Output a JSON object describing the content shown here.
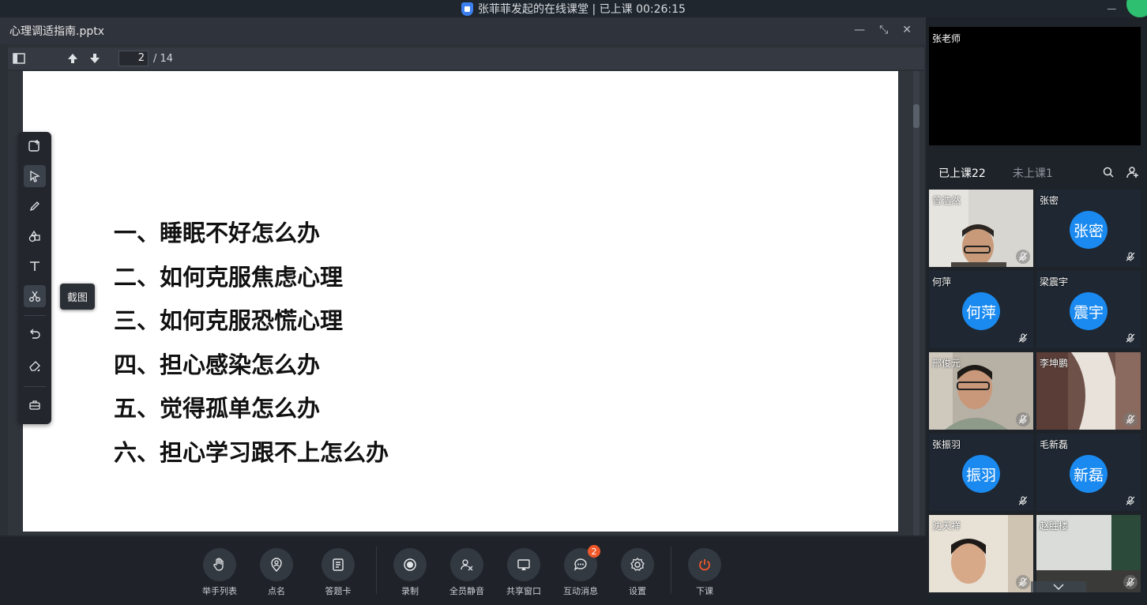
{
  "window": {
    "title": "张菲菲发起的在线课堂 | 已上课 00:26:15"
  },
  "document": {
    "filename": "心理调适指南.pptx",
    "current_page": "2",
    "total_pages": "/ 14",
    "slide_items": [
      "一、睡眠不好怎么办",
      "二、如何克服焦虑心理",
      "三、如何克服恐慌心理",
      "四、担心感染怎么办",
      "五、觉得孤单怎么办",
      "六、担心学习跟不上怎么办"
    ]
  },
  "draw_tools": {
    "tooltip": "截图"
  },
  "bottom_bar": {
    "buttons": [
      {
        "label": "举手列表",
        "icon": "hand-icon"
      },
      {
        "label": "点名",
        "icon": "roll-call-icon"
      },
      {
        "label": "答题卡",
        "icon": "answer-card-icon"
      },
      {
        "label": "录制",
        "icon": "record-icon"
      },
      {
        "label": "全员静音",
        "icon": "mute-all-icon"
      },
      {
        "label": "共享窗口",
        "icon": "share-window-icon"
      },
      {
        "label": "互动消息",
        "icon": "chat-icon",
        "badge": "2"
      },
      {
        "label": "设置",
        "icon": "gear-icon"
      },
      {
        "label": "下课",
        "icon": "power-icon"
      }
    ]
  },
  "side": {
    "teacher_name": "张老师",
    "tab_attending": "已上课22",
    "tab_absent": "未上课1",
    "participants": [
      {
        "name": "曾浩然",
        "avatar": "",
        "type": "video"
      },
      {
        "name": "张密",
        "avatar": "张密",
        "type": "avatar"
      },
      {
        "name": "何萍",
        "avatar": "何萍",
        "type": "avatar"
      },
      {
        "name": "梁震宇",
        "avatar": "震宇",
        "type": "avatar"
      },
      {
        "name": "邢俊元",
        "avatar": "",
        "type": "video"
      },
      {
        "name": "李坤鹏",
        "avatar": "",
        "type": "video"
      },
      {
        "name": "张振羽",
        "avatar": "振羽",
        "type": "avatar"
      },
      {
        "name": "毛新磊",
        "avatar": "新磊",
        "type": "avatar"
      },
      {
        "name": "沈天祥",
        "avatar": "",
        "type": "video"
      },
      {
        "name": "赵胜楼",
        "avatar": "",
        "type": "video"
      }
    ]
  },
  "colors": {
    "accent_blue": "#1a8af0",
    "badge_red": "#f0582a",
    "lock_blue": "#3b7ff0"
  }
}
